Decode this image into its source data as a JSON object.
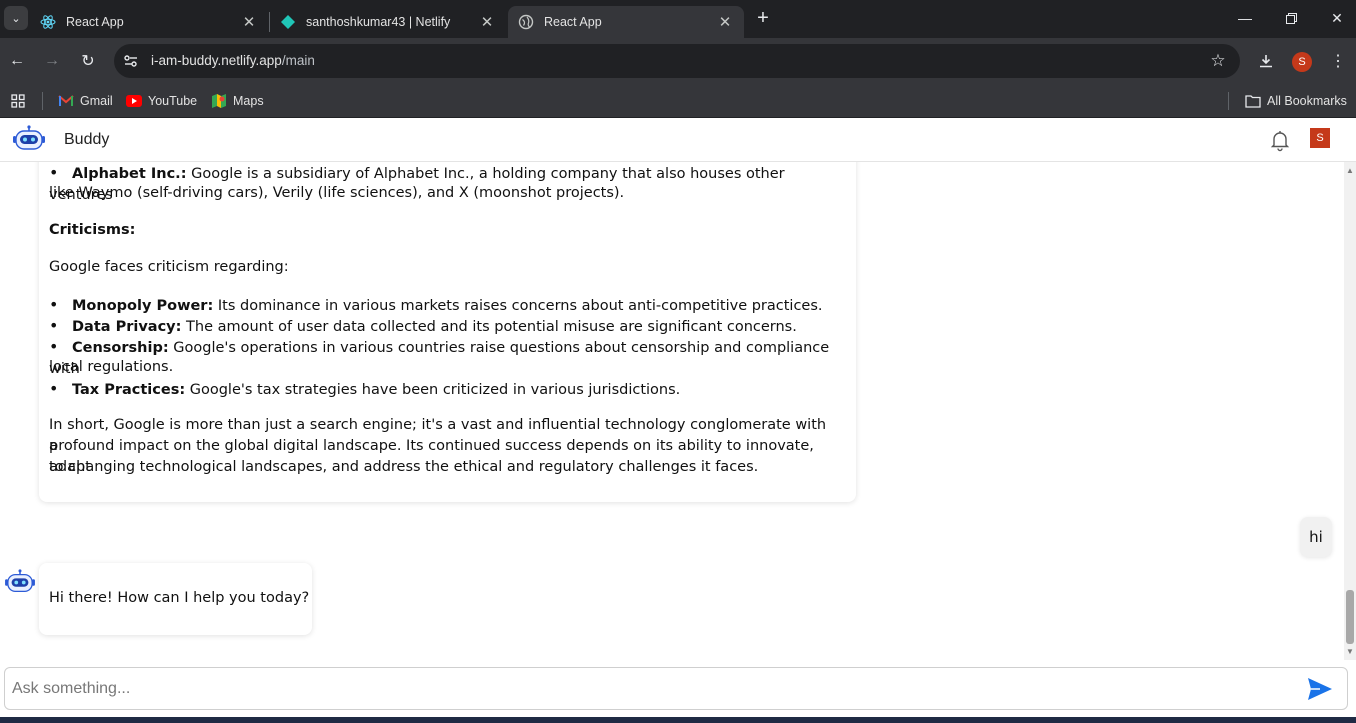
{
  "browser": {
    "tabs": [
      {
        "label": "React App",
        "active": false
      },
      {
        "label": "santhoshkumar43 | Netlify",
        "active": false
      },
      {
        "label": "React App",
        "active": true
      }
    ],
    "url_host": "i-am-buddy.netlify.app",
    "url_path": "/main",
    "profile_initial": "S",
    "bookmarks": [
      {
        "label": "Gmail",
        "icon": "gmail-icon"
      },
      {
        "label": "YouTube",
        "icon": "youtube-icon"
      },
      {
        "label": "Maps",
        "icon": "maps-icon"
      }
    ],
    "all_bookmarks": "All Bookmarks"
  },
  "app": {
    "title": "Buddy",
    "user_initial": "S",
    "accent": "#1a73e8"
  },
  "chat": {
    "long_reply": {
      "intro_bullet": {
        "bold": "Alphabet Inc.:",
        "text": " Google is a subsidiary of Alphabet Inc., a holding company that also houses other ventures",
        "cont": "like Waymo (self-driving cars), Verily (life sciences), and X (moonshot projects)."
      },
      "criticisms_heading": "Criticisms:",
      "criticisms_intro": "Google faces criticism regarding:",
      "bullets": [
        {
          "bold": "Monopoly Power:",
          "text": " Its dominance in various markets raises concerns about anti-competitive practices."
        },
        {
          "bold": "Data Privacy:",
          "text": " The amount of user data collected and its potential misuse are significant concerns."
        },
        {
          "bold": "Censorship:",
          "text": " Google's operations in various countries raise questions about censorship and compliance with",
          "cont": "local regulations."
        },
        {
          "bold": "Tax Practices:",
          "text": " Google's tax strategies have been criticized in various jurisdictions."
        }
      ],
      "summary_lines": [
        "In short, Google is more than just a search engine; it's a vast and influential technology conglomerate with a",
        "profound impact on the global digital landscape. Its continued success depends on its ability to innovate, adapt",
        "to changing technological landscapes, and address the ethical and regulatory challenges it faces."
      ]
    },
    "user_message": "hi",
    "bot_reply": "Hi there! How can I help you today?"
  },
  "input": {
    "placeholder": "Ask something...",
    "value": ""
  }
}
